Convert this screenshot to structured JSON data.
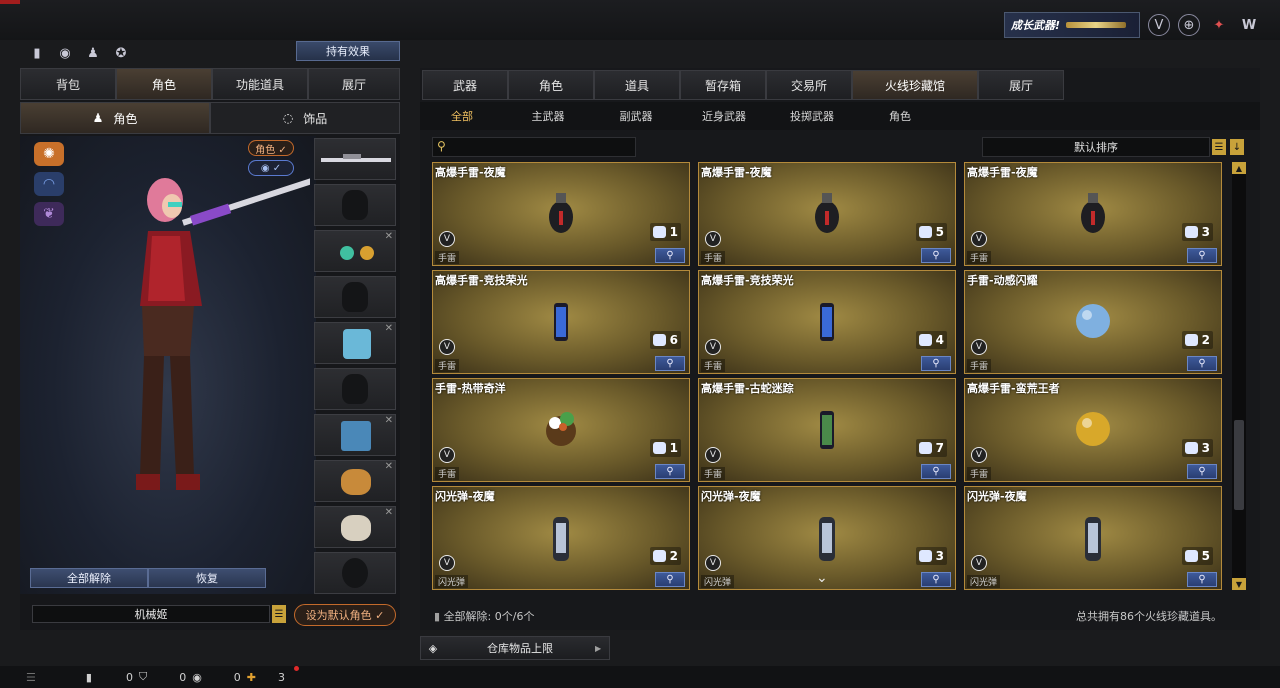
{
  "top": {
    "grow_banner": "成长武器!",
    "left_icons": [
      "stats-icon",
      "eye-target-icon",
      "person-run-icon",
      "bag-icon"
    ],
    "right_icons": [
      "shield-v-icon",
      "globe-icon",
      "trophy-icon",
      "w-logo-icon"
    ]
  },
  "left": {
    "effects_button": "持有效果",
    "tabs": [
      "背包",
      "角色",
      "功能道具",
      "展厅"
    ],
    "sub_tabs": [
      "角色",
      "饰品"
    ],
    "pill_role": "角色 ✓",
    "pill_eye": "◉ ✓",
    "clear_all": "全部解除",
    "restore": "恢复",
    "char_name": "机械姬",
    "set_default": "设为默认角色 ✓"
  },
  "right": {
    "tabs": [
      "武器",
      "角色",
      "道具",
      "暂存箱",
      "交易所",
      "火线珍藏馆",
      "展厅"
    ],
    "categories": [
      "全部",
      "主武器",
      "副武器",
      "近身武器",
      "投掷武器",
      "角色"
    ],
    "sort_label": "默认排序",
    "items": [
      {
        "name": "高爆手雷-夜魔",
        "tag": "手雷",
        "count": "1",
        "color": "#c22a2a",
        "kind": "frag"
      },
      {
        "name": "高爆手雷-夜魔",
        "tag": "手雷",
        "count": "5",
        "color": "#c22a2a",
        "kind": "frag"
      },
      {
        "name": "高爆手雷-夜魔",
        "tag": "手雷",
        "count": "3",
        "color": "#c22a2a",
        "kind": "frag"
      },
      {
        "name": "高爆手雷-竞技荣光",
        "tag": "手雷",
        "count": "6",
        "color": "#3a6ad8",
        "kind": "cyl"
      },
      {
        "name": "高爆手雷-竞技荣光",
        "tag": "手雷",
        "count": "4",
        "color": "#3a6ad8",
        "kind": "cyl"
      },
      {
        "name": "手雷-动感闪耀",
        "tag": "手雷",
        "count": "2",
        "color": "#7fb0e0",
        "kind": "ball"
      },
      {
        "name": "手雷-热带奇洋",
        "tag": "手雷",
        "count": "1",
        "color": "#c8602a",
        "kind": "fruit"
      },
      {
        "name": "高爆手雷-古蛇迷踪",
        "tag": "手雷",
        "count": "7",
        "color": "#4a8a4a",
        "kind": "cyl"
      },
      {
        "name": "高爆手雷-蛮荒王者",
        "tag": "手雷",
        "count": "3",
        "color": "#d8a82a",
        "kind": "ball"
      },
      {
        "name": "闪光弹-夜魔",
        "tag": "闪光弹",
        "count": "2",
        "color": "#b8c4d8",
        "kind": "flash"
      },
      {
        "name": "闪光弹-夜魔",
        "tag": "闪光弹",
        "count": "3",
        "color": "#b8c4d8",
        "kind": "flash"
      },
      {
        "name": "闪光弹-夜魔",
        "tag": "闪光弹",
        "count": "5",
        "color": "#b8c4d8",
        "kind": "flash"
      }
    ],
    "footer_clear": "全部解除: 0个/6个",
    "footer_total": "总共拥有86个火线珍藏道具。",
    "warehouse": "仓库物品上限"
  },
  "bottom": {
    "items": [
      {
        "icon": "bottle-icon",
        "value": "0"
      },
      {
        "icon": "shield-icon",
        "value": "0"
      },
      {
        "icon": "eye-icon",
        "value": "0"
      },
      {
        "icon": "gift-icon",
        "value": "3"
      }
    ]
  }
}
